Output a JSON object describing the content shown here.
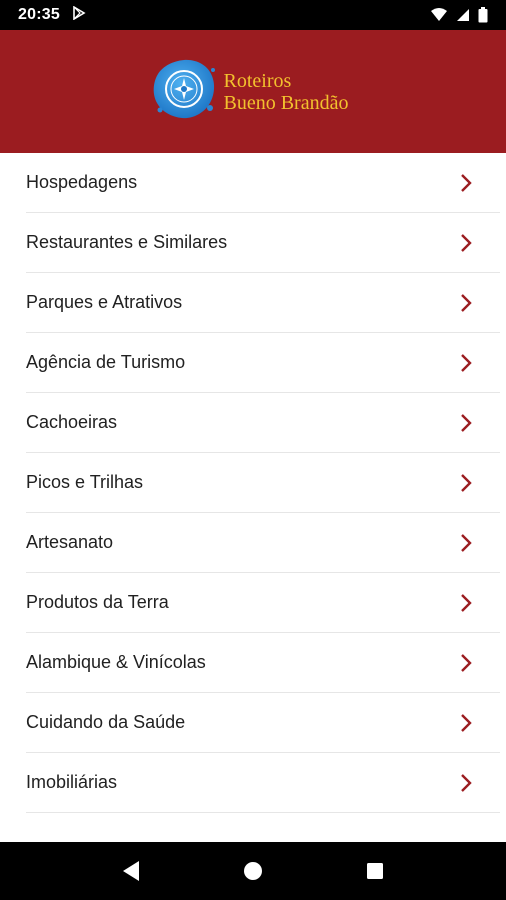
{
  "status_bar": {
    "time": "20:35",
    "icons": [
      "play-store-icon",
      "wifi-icon",
      "signal-icon",
      "battery-icon"
    ]
  },
  "header": {
    "logo_line1": "Roteiros",
    "logo_line2": "Bueno Brandão",
    "background_color": "#9b1c20",
    "text_color": "#f2c12e"
  },
  "menu": {
    "items": [
      {
        "label": "Hospedagens"
      },
      {
        "label": "Restaurantes e Similares"
      },
      {
        "label": "Parques e Atrativos"
      },
      {
        "label": "Agência de Turismo"
      },
      {
        "label": "Cachoeiras"
      },
      {
        "label": "Picos e Trilhas"
      },
      {
        "label": "Artesanato"
      },
      {
        "label": "Produtos da Terra"
      },
      {
        "label": "Alambique & Vinícolas"
      },
      {
        "label": "Cuidando da Saúde"
      },
      {
        "label": "Imobiliárias"
      }
    ],
    "chevron_color": "#9b1c20"
  },
  "nav_bar": {
    "buttons": [
      "back-icon",
      "home-icon",
      "recents-icon"
    ]
  }
}
